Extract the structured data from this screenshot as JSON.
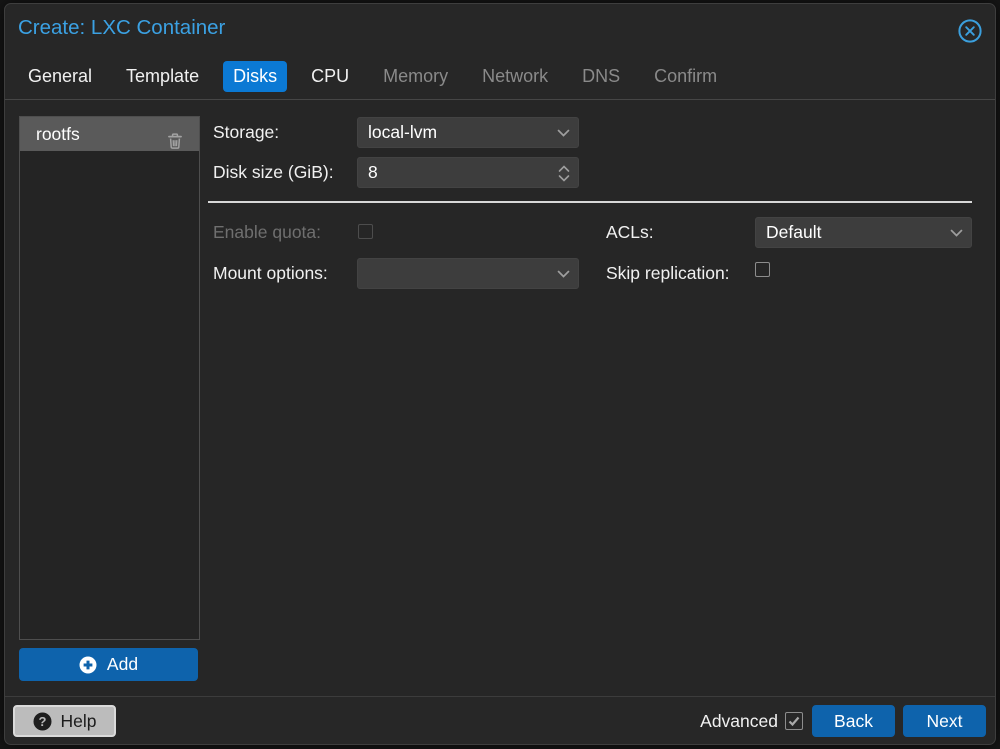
{
  "window": {
    "title": "Create: LXC Container",
    "close_icon": "x-circle"
  },
  "tabs": [
    {
      "label": "General",
      "state": "normal"
    },
    {
      "label": "Template",
      "state": "normal"
    },
    {
      "label": "Disks",
      "state": "active"
    },
    {
      "label": "CPU",
      "state": "normal"
    },
    {
      "label": "Memory",
      "state": "disabled"
    },
    {
      "label": "Network",
      "state": "disabled"
    },
    {
      "label": "DNS",
      "state": "disabled"
    },
    {
      "label": "Confirm",
      "state": "disabled"
    }
  ],
  "disk_list": {
    "items": [
      {
        "label": "rootfs",
        "selected": true,
        "delete_icon": "trash"
      }
    ],
    "add_button": {
      "label": "Add",
      "icon": "plus-circle"
    }
  },
  "form": {
    "storage": {
      "label": "Storage:",
      "value": "local-lvm",
      "control": "dropdown"
    },
    "disk_size": {
      "label": "Disk size (GiB):",
      "value": "8",
      "control": "number-spinner"
    },
    "enable_quota": {
      "label": "Enable quota:",
      "checked": false,
      "disabled": true,
      "control": "checkbox"
    },
    "acls": {
      "label": "ACLs:",
      "value": "Default",
      "control": "dropdown"
    },
    "mount_options": {
      "label": "Mount options:",
      "value": "",
      "control": "dropdown"
    },
    "skip_replication": {
      "label": "Skip replication:",
      "checked": false,
      "disabled": false,
      "control": "checkbox"
    }
  },
  "footer": {
    "help_button": {
      "label": "Help",
      "icon": "question-circle"
    },
    "advanced_checkbox": {
      "label": "Advanced",
      "checked": true
    },
    "back_button": {
      "label": "Back"
    },
    "next_button": {
      "label": "Next"
    }
  },
  "colors": {
    "accent_blue": "#0b79d4",
    "button_blue": "#0e63ac",
    "title_blue": "#3ba1e3",
    "dialog_bg": "#272727",
    "selected_row": "#5a5a5a"
  }
}
